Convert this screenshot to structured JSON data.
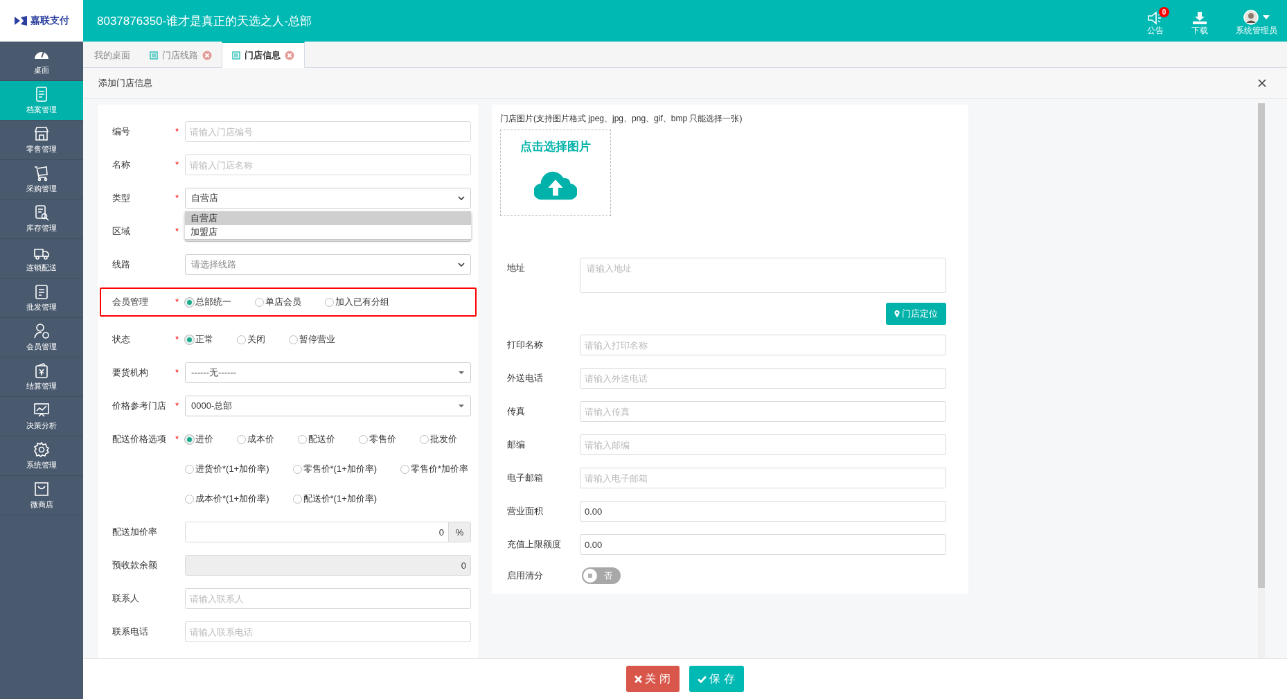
{
  "header": {
    "logo_text": "嘉联支付",
    "title": "8037876350-谁才是真正的天选之人-总部",
    "notice": {
      "label": "公告",
      "badge": "0"
    },
    "download": {
      "label": "下载"
    },
    "user": {
      "label": "系统管理员"
    }
  },
  "sidebar": {
    "items": [
      {
        "label": "桌面",
        "selected": false
      },
      {
        "label": "档案管理",
        "selected": true
      },
      {
        "label": "零售管理",
        "selected": false
      },
      {
        "label": "采购管理",
        "selected": false
      },
      {
        "label": "库存管理",
        "selected": false
      },
      {
        "label": "连锁配送",
        "selected": false
      },
      {
        "label": "批发管理",
        "selected": false
      },
      {
        "label": "会员管理",
        "selected": false
      },
      {
        "label": "结算管理",
        "selected": false
      },
      {
        "label": "决策分析",
        "selected": false
      },
      {
        "label": "系统管理",
        "selected": false
      },
      {
        "label": "微商店",
        "selected": false
      }
    ]
  },
  "tabs": [
    {
      "label": "我的桌面",
      "selected": false,
      "closable": false
    },
    {
      "label": "门店线路",
      "selected": false,
      "closable": true
    },
    {
      "label": "门店信息",
      "selected": true,
      "closable": true
    }
  ],
  "dialog": {
    "title": "添加门店信息"
  },
  "left_form": [
    {
      "kind": "input",
      "label": "编号",
      "required_mark": "*",
      "placeholder": "请输入门店编号"
    },
    {
      "kind": "input",
      "label": "名称",
      "required_mark": "*",
      "placeholder": "请输入门店名称"
    },
    {
      "kind": "select",
      "label": "类型",
      "required_mark": "*",
      "value": "自营店",
      "dropdown": [
        {
          "label": "自营店",
          "selected": true
        },
        {
          "label": "加盟店",
          "selected": false
        }
      ]
    },
    {
      "kind": "select",
      "label": "区域",
      "required_mark": "*"
    },
    {
      "kind": "select",
      "label": "线路",
      "placeholder": "请选择线路"
    },
    {
      "kind": "radio",
      "label": "会员管理",
      "required_mark": "*",
      "highlighted": true,
      "option_lines": [
        [
          {
            "label": "总部统一",
            "selected": true
          },
          {
            "label": "单店会员",
            "selected": false
          },
          {
            "label": "加入已有分组",
            "selected": false
          }
        ]
      ]
    },
    {
      "kind": "radio",
      "label": "状态",
      "required_mark": "*",
      "option_lines": [
        [
          {
            "label": "正常",
            "selected": true
          },
          {
            "label": "关闭",
            "selected": false
          },
          {
            "label": "暂停营业",
            "selected": false
          }
        ]
      ]
    },
    {
      "kind": "combo",
      "label": "要货机构",
      "required_mark": "*",
      "value": "------无------"
    },
    {
      "kind": "combo",
      "label": "价格参考门店",
      "required_mark": "*",
      "value": "0000-总部"
    },
    {
      "kind": "radio",
      "label": "配送价格选项",
      "required_mark": "*",
      "option_lines": [
        [
          {
            "label": "进价",
            "selected": true
          },
          {
            "label": "成本价",
            "selected": false
          },
          {
            "label": "配送价",
            "selected": false
          },
          {
            "label": "零售价",
            "selected": false
          },
          {
            "label": "批发价",
            "selected": false
          }
        ],
        [
          {
            "label": "进货价*(1+加价率)",
            "selected": false
          },
          {
            "label": "零售价*(1+加价率)",
            "selected": false
          },
          {
            "label": "零售价*加价率",
            "selected": false
          }
        ],
        [
          {
            "label": "成本价*(1+加价率)",
            "selected": false
          },
          {
            "label": "配送价*(1+加价率)",
            "selected": false
          }
        ]
      ]
    },
    {
      "kind": "addon",
      "label": "配送加价率",
      "value": "0",
      "addon": "%"
    },
    {
      "kind": "readonly",
      "label": "预收款余额",
      "value": "0"
    },
    {
      "kind": "input",
      "label": "联系人",
      "placeholder": "请输入联系人"
    },
    {
      "kind": "input",
      "label": "联系电话",
      "placeholder": "请输入联系电话"
    }
  ],
  "image_upload": {
    "hint": "门店图片(支持图片格式 jpeg、jpg、png、gif、bmp 只能选择一张)",
    "label": "点击选择图片"
  },
  "right_form": [
    {
      "kind": "textarea",
      "label": "地址",
      "placeholder": "请输入地址"
    },
    {
      "kind": "button",
      "label": "门店定位"
    },
    {
      "kind": "input",
      "label": "打印名称",
      "placeholder": "请输入打印名称"
    },
    {
      "kind": "input",
      "label": "外送电话",
      "placeholder": "请输入外送电话"
    },
    {
      "kind": "input",
      "label": "传真",
      "placeholder": "请输入传真"
    },
    {
      "kind": "input",
      "label": "邮编",
      "placeholder": "请输入邮编"
    },
    {
      "kind": "input",
      "label": "电子邮箱",
      "placeholder": "请输入电子邮箱"
    },
    {
      "kind": "input",
      "label": "营业面积",
      "value": "0.00"
    },
    {
      "kind": "input",
      "label": "充值上限额度",
      "value": "0.00"
    },
    {
      "kind": "switch",
      "label": "启用清分",
      "on": false,
      "state_text": "否"
    }
  ],
  "footer_buttons": [
    {
      "kind": "close",
      "label": "关闭"
    },
    {
      "kind": "save",
      "label": "保存"
    }
  ]
}
